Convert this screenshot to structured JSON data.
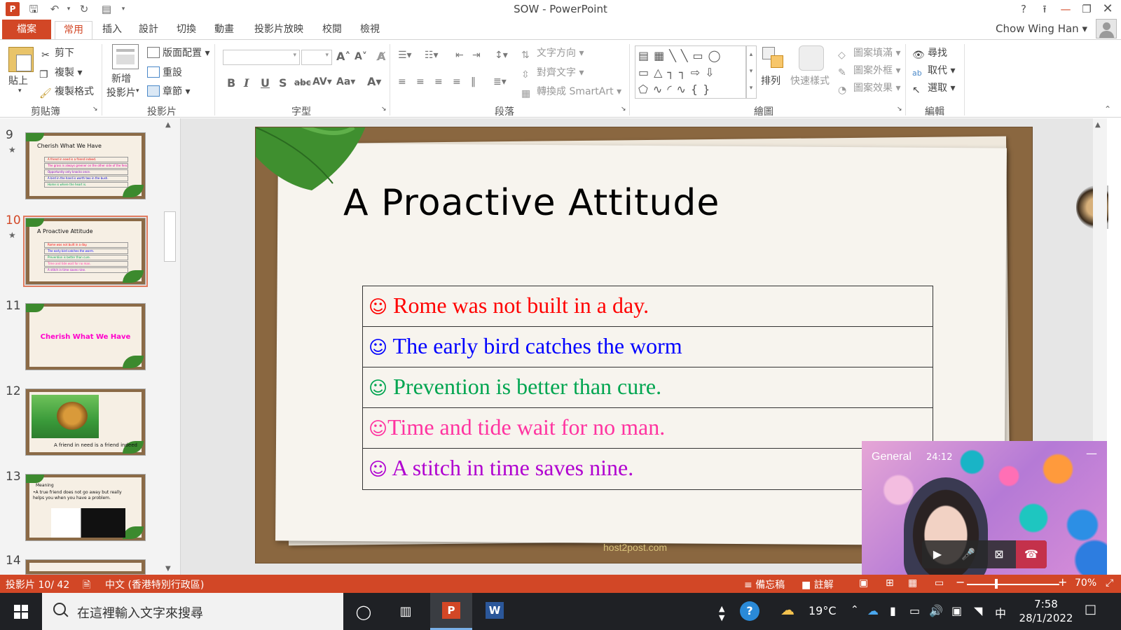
{
  "window": {
    "title": "SOW - PowerPoint",
    "help": "?",
    "user_name": "Chow Wing Han"
  },
  "tabs": [
    "檔案",
    "常用",
    "插入",
    "設計",
    "切換",
    "動畫",
    "投影片放映",
    "校閱",
    "檢視"
  ],
  "ribbon": {
    "clipboard": {
      "paste": "貼上",
      "cut": "剪下",
      "copy": "複製",
      "format_painter": "複製格式",
      "label": "剪貼簿"
    },
    "slides": {
      "new_slide": "新增\n投影片",
      "layout": "版面配置",
      "reset": "重設",
      "section": "章節",
      "label": "投影片"
    },
    "font": {
      "label": "字型"
    },
    "paragraph": {
      "text_direction": "文字方向",
      "align_text": "對齊文字",
      "smartart": "轉換成 SmartArt",
      "label": "段落"
    },
    "drawing": {
      "arrange": "排列",
      "quick_styles": "快速樣式",
      "shape_fill": "圖案填滿",
      "shape_outline": "圖案外框",
      "shape_effects": "圖案效果",
      "label": "繪圖"
    },
    "editing": {
      "find": "尋找",
      "replace": "取代",
      "select": "選取",
      "label": "編輯"
    }
  },
  "thumbnails": [
    {
      "num": "9",
      "title": "Cherish What We Have",
      "lines": [
        "A friend in need is a friend indeed.",
        "The grass is always greener on the other side of the fence.",
        "Opportunity only knocks once.",
        "A bird in the hand is worth two in the bush.",
        "Home is where the heart is."
      ]
    },
    {
      "num": "10",
      "title": "A Proactive Attitude",
      "lines": [
        "Rome was not built in a day.",
        "The early bird catches the worm.",
        "Prevention is better than cure.",
        "Time and tide wait for no man.",
        "A stitch in time saves nine."
      ]
    },
    {
      "num": "11",
      "center": "Cherish What We Have"
    },
    {
      "num": "12",
      "caption": "A friend in need is a friend indeed"
    },
    {
      "num": "13",
      "heading": "Meaning",
      "body": "•A true friend does not go away but really helps you when you have a problem."
    },
    {
      "num": "14"
    }
  ],
  "slide": {
    "title": "A Proactive Attitude",
    "proverbs": [
      {
        "smile": "☺",
        "text": " Rome was not built in a day.",
        "color": "#ff0000"
      },
      {
        "smile": "☺",
        "text": " The early bird catches the worm",
        "color": "#0000ff"
      },
      {
        "smile": "☺",
        "text": " Prevention is better than cure.",
        "color": "#00a550"
      },
      {
        "smile": "☺",
        "text": "Time and tide wait for no man.",
        "color": "#ff33a0"
      },
      {
        "smile": "☺",
        "text": " A stitch in time saves nine.",
        "color": "#b000d0"
      }
    ],
    "watermark": "host2post.com"
  },
  "teams": {
    "channel": "General",
    "elapsed": "24:12"
  },
  "status": {
    "slide_counter": "投影片 10/ 42",
    "language": "中文 (香港特別行政區)",
    "notes": "備忘稿",
    "comments": "註解",
    "zoom": "70%"
  },
  "taskbar": {
    "search_placeholder": "在這裡輸入文字來搜尋",
    "temperature": "19°C",
    "ime": "中",
    "time": "7:58",
    "date": "28/1/2022"
  },
  "colors": {
    "accent": "#d24726"
  }
}
